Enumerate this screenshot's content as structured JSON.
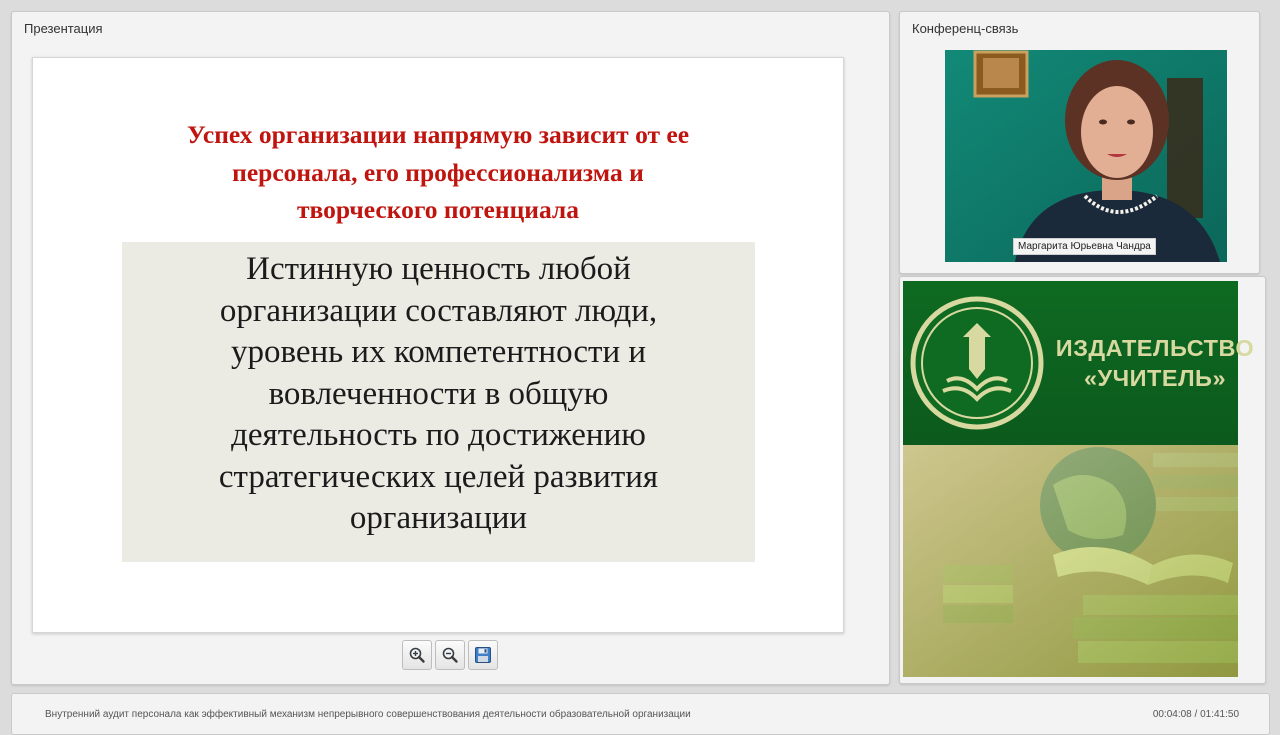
{
  "presentation_panel": {
    "title": "Презентация",
    "slide": {
      "heading_lines": [
        "Успех организации напрямую зависит от ее",
        "персонала, его профессионализма и",
        "творческого потенциала"
      ],
      "body_lines": [
        "Истинную ценность любой",
        "организации составляют люди,",
        "уровень их компетентности и",
        "вовлеченности в общую",
        "деятельность по достижению",
        "стратегических целей развития",
        "организации"
      ],
      "colors": {
        "heading": "#c0140f",
        "box_bg": "#ebebe4"
      }
    },
    "toolbar": {
      "zoom_in_icon": "zoom-in-icon",
      "zoom_out_icon": "zoom-out-icon",
      "save_icon": "save-icon"
    }
  },
  "conference_panel": {
    "title": "Конференц-связь",
    "participant_name": "Маргарита Юрьевна Чандра"
  },
  "ad_panel": {
    "brand_line1": "ИЗДАТЕЛЬСТВО",
    "brand_line2": "«УЧИТЕЛЬ»",
    "colors": {
      "green": "#0e6a21",
      "gold": "#d8d9a0"
    }
  },
  "bottom_bar": {
    "lesson_title": "Внутренний аудит персонала как эффективный механизм непрерывного совершенствования деятельности образовательной организации",
    "time": "00:04:08 / 01:41:50"
  }
}
